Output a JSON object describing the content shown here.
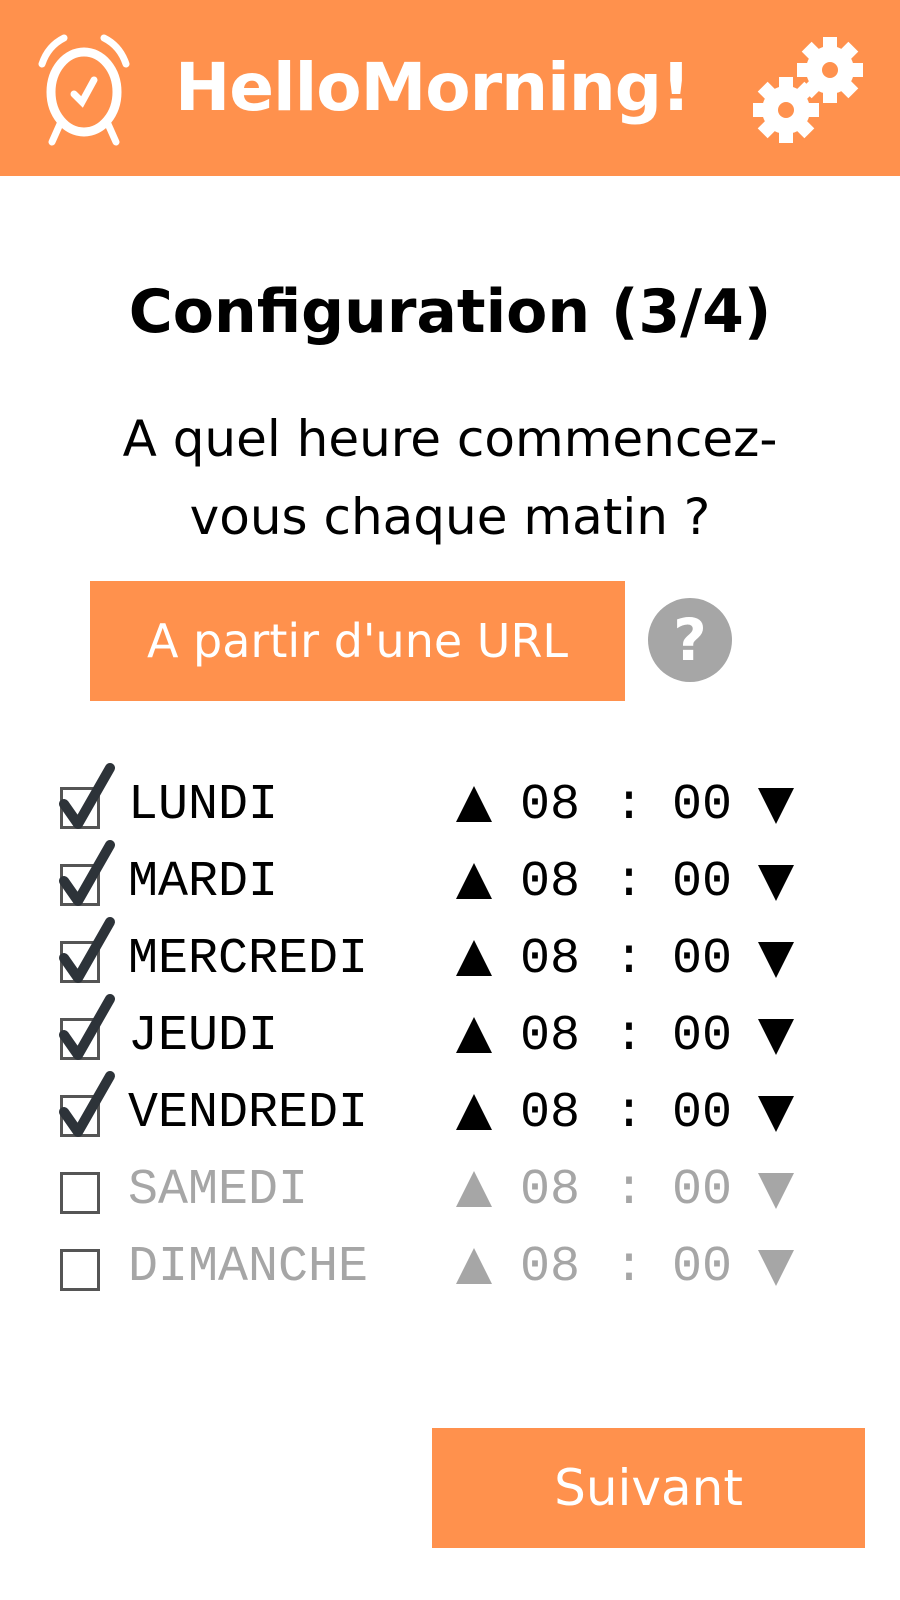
{
  "header": {
    "title": "HelloMorning!",
    "logo_icon": "alarm-clock-icon",
    "settings_icon": "gears-icon"
  },
  "main": {
    "title": "Configuration (3/4)",
    "question_line1": "A quel heure commencez-",
    "question_line2": "vous chaque matin ?",
    "url_button": "A partir d'une URL",
    "help_label": "?",
    "separator": ":",
    "days": [
      {
        "label": "LUNDI",
        "checked": true,
        "hour": "08",
        "minute": "00"
      },
      {
        "label": "MARDI",
        "checked": true,
        "hour": "08",
        "minute": "00"
      },
      {
        "label": "MERCREDI",
        "checked": true,
        "hour": "08",
        "minute": "00"
      },
      {
        "label": "JEUDI",
        "checked": true,
        "hour": "08",
        "minute": "00"
      },
      {
        "label": "VENDREDI",
        "checked": true,
        "hour": "08",
        "minute": "00"
      },
      {
        "label": "SAMEDI",
        "checked": false,
        "hour": "08",
        "minute": "00"
      },
      {
        "label": "DIMANCHE",
        "checked": false,
        "hour": "08",
        "minute": "00"
      }
    ],
    "next_button": "Suivant"
  },
  "colors": {
    "accent": "#ff914d",
    "disabled": "#a6a6a6",
    "help": "#a6a6a6"
  }
}
